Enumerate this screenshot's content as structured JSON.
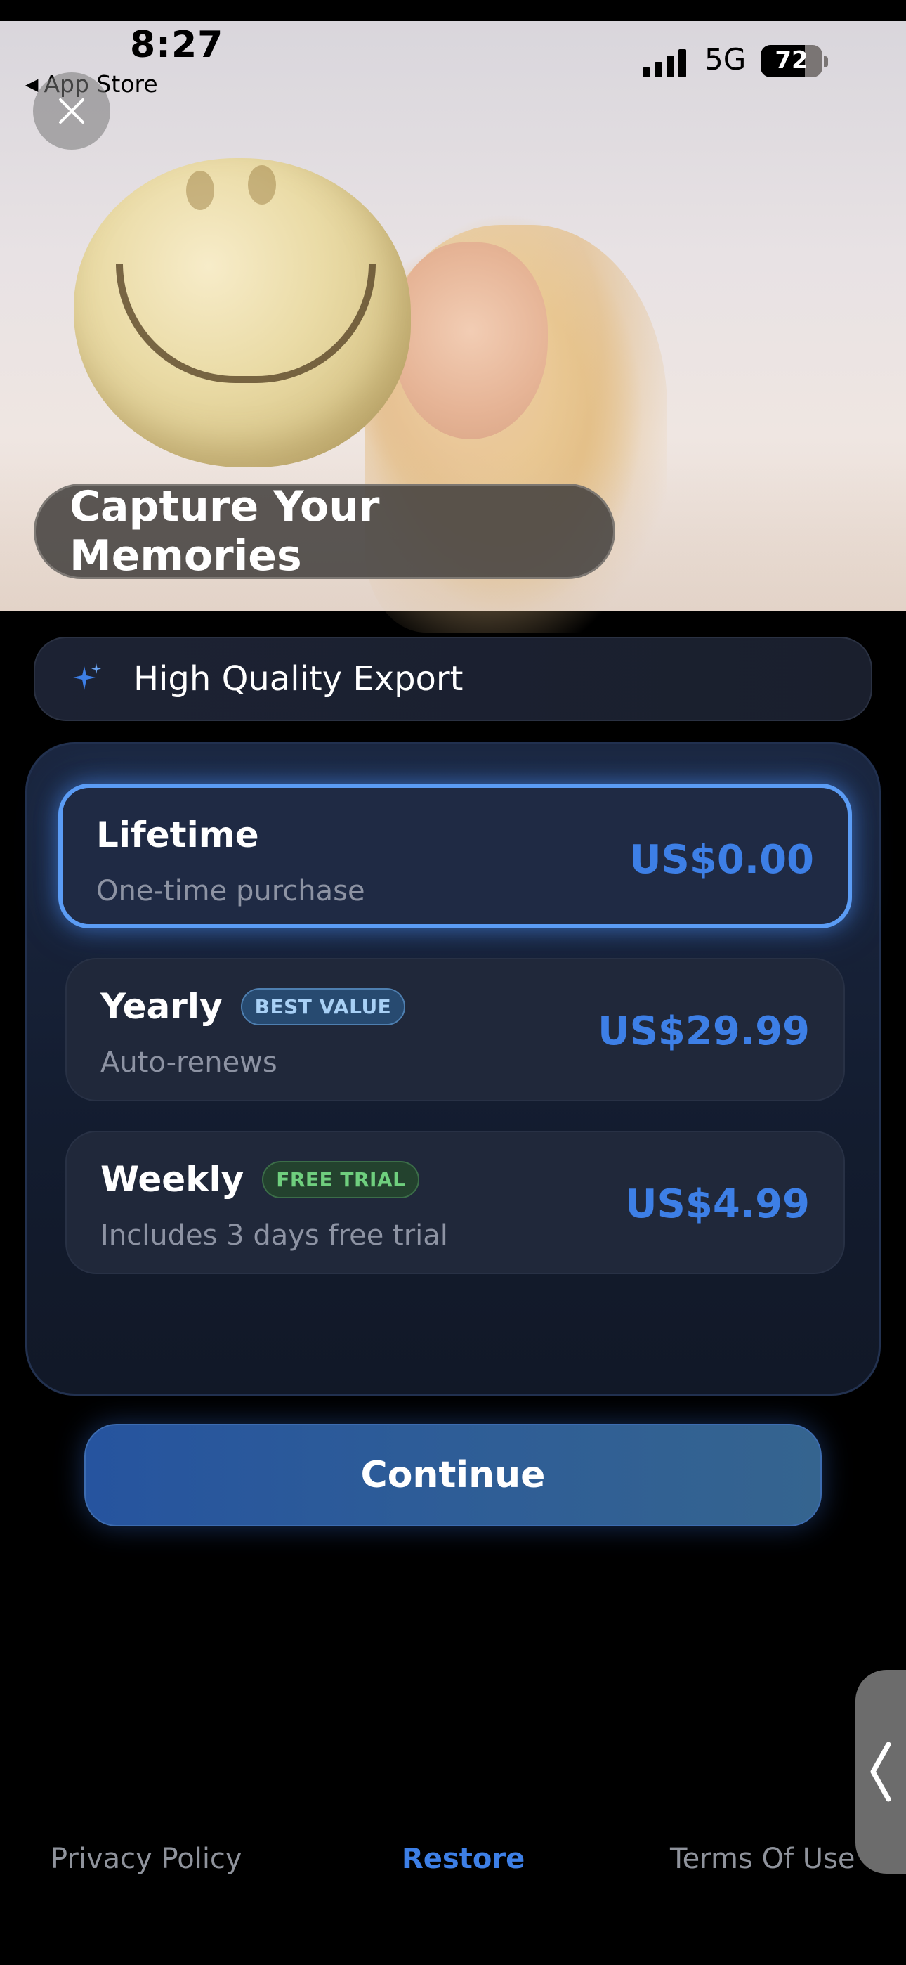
{
  "status_bar": {
    "time": "8:27",
    "back_label": "App Store",
    "network": "5G",
    "battery_level": "72",
    "battery_fraction": 0.72
  },
  "hero": {
    "headline": "Capture Your Memories"
  },
  "feature": {
    "icon": "sparkle-icon",
    "label": "High Quality Export"
  },
  "plans": [
    {
      "title": "Lifetime",
      "subtitle": "One-time purchase",
      "price": "US$0.00",
      "badge": "",
      "selected": true
    },
    {
      "title": "Yearly",
      "subtitle": "Auto-renews",
      "price": "US$29.99",
      "badge": "BEST VALUE",
      "selected": false
    },
    {
      "title": "Weekly",
      "subtitle": "Includes 3 days free trial",
      "price": "US$4.99",
      "badge": "FREE TRIAL",
      "selected": false
    }
  ],
  "continue_label": "Continue",
  "footer": {
    "privacy": "Privacy Policy",
    "restore": "Restore",
    "terms": "Terms Of Use"
  },
  "colors": {
    "accent": "#3d7fe6",
    "selected_border": "#5b9cf5",
    "best_value_badge": "#274a70",
    "free_trial_badge": "#23422e"
  }
}
